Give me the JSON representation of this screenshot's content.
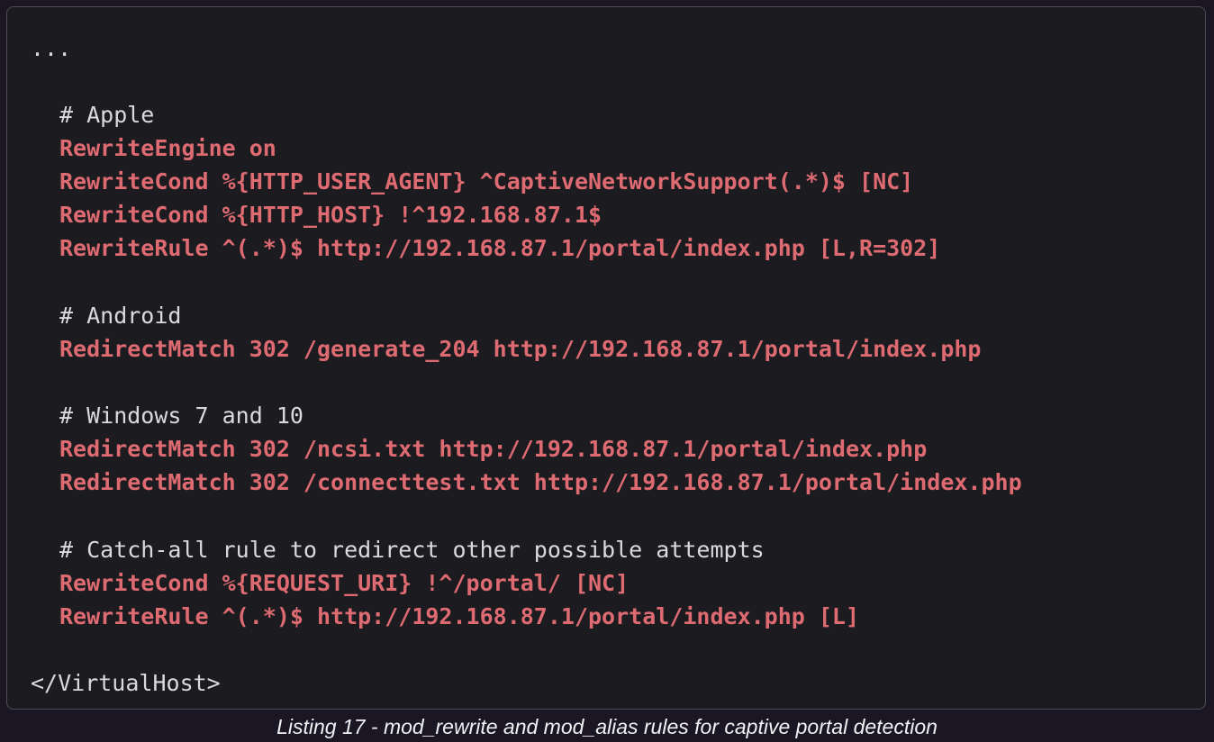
{
  "listing": {
    "lines": {
      "ellipsis": "...",
      "comment_apple": "# Apple",
      "rewrite_engine": "RewriteEngine on",
      "rewrite_cond_user_agent": "RewriteCond %{HTTP_USER_AGENT} ^CaptiveNetworkSupport(.*)$ [NC]",
      "rewrite_cond_host": "RewriteCond %{HTTP_HOST} !^192.168.87.1$",
      "rewrite_rule_apple": "RewriteRule ^(.*)$ http://192.168.87.1/portal/index.php [L,R=302]",
      "comment_android": "# Android",
      "redirect_generate_204": "RedirectMatch 302 /generate_204 http://192.168.87.1/portal/index.php",
      "comment_windows": "# Windows 7 and 10",
      "redirect_ncsi": "RedirectMatch 302 /ncsi.txt http://192.168.87.1/portal/index.php",
      "redirect_connecttest": "RedirectMatch 302 /connecttest.txt http://192.168.87.1/portal/index.php",
      "comment_catch_all": "# Catch-all rule to redirect other possible attempts",
      "rewrite_cond_request_uri": "RewriteCond %{REQUEST_URI} !^/portal/ [NC]",
      "rewrite_rule_catch_all": "RewriteRule ^(.*)$ http://192.168.87.1/portal/index.php [L]",
      "virtualhost_close": "</VirtualHost>"
    },
    "caption": "Listing 17 - mod_rewrite and mod_alias rules for captive portal detection"
  },
  "colors": {
    "page_background": "#1a1624",
    "code_background": "#1c1b20",
    "code_border": "#4e4d57",
    "plain_text": "#d9d9de",
    "directive_text": "#de6b72",
    "caption_text": "#f1f1f4"
  }
}
